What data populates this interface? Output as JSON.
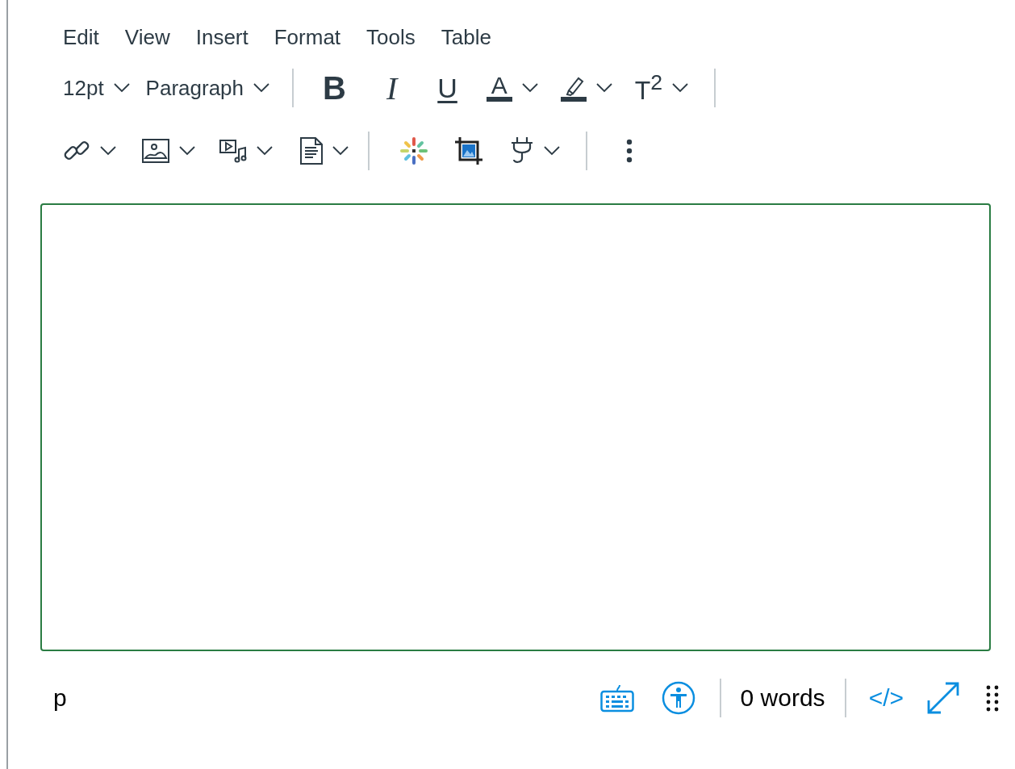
{
  "menubar": [
    "Edit",
    "View",
    "Insert",
    "Format",
    "Tools",
    "Table"
  ],
  "toolbar": {
    "font_size": "12pt",
    "block_format": "Paragraph",
    "bold": "B",
    "italic": "I",
    "underline": "U",
    "text_color": "A",
    "superscript": "T$^{2}$"
  },
  "status_bar": {
    "element_path": "p",
    "word_count": "0 words",
    "html_toggle": "</>"
  }
}
